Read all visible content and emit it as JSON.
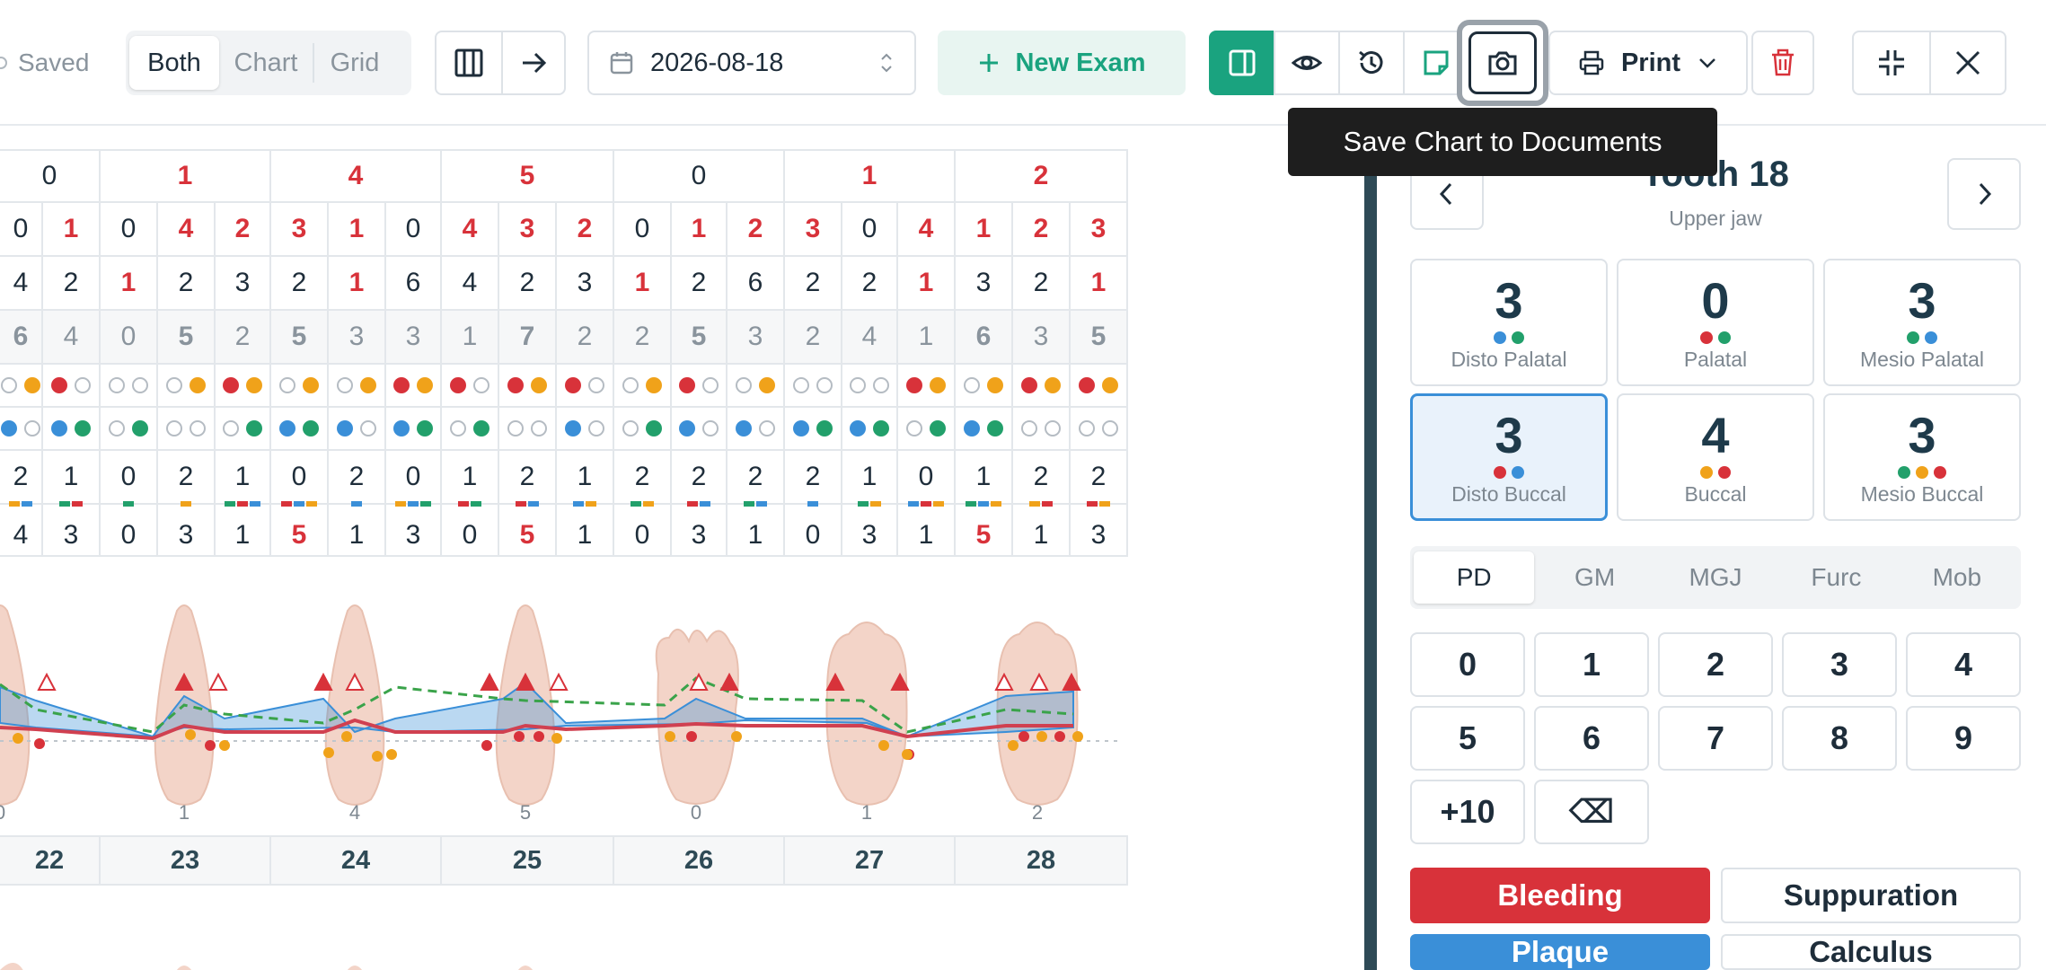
{
  "toolbar": {
    "saved_label": "Saved",
    "view_options": [
      "Both",
      "Chart",
      "Grid"
    ],
    "active_view": "Both",
    "date_value": "2026-08-18",
    "new_exam_label": "New Exam",
    "print_label": "Print",
    "tooltip": "Save Chart to Documents"
  },
  "colors": {
    "accent": "#1aa37f",
    "red": "#d8323a",
    "orange": "#f0a21a",
    "blue": "#3a8fd8",
    "green": "#22a06b",
    "dark": "#1e2d3a"
  },
  "grid": {
    "header_values": [
      "0",
      "1",
      "4",
      "5",
      "0",
      "1",
      "2"
    ],
    "pd_row": [
      "0",
      "1",
      "0",
      "4",
      "2",
      "3",
      "1",
      "0",
      "4",
      "3",
      "2",
      "0",
      "1",
      "2",
      "3",
      "0",
      "4",
      "1",
      "2",
      "3"
    ],
    "cal_row": [
      "4",
      "2",
      "1",
      "2",
      "3",
      "2",
      "1",
      "6",
      "4",
      "2",
      "3",
      "1",
      "2",
      "6",
      "2",
      "2",
      "1",
      "3",
      "2",
      "1"
    ],
    "gm_row": [
      "6",
      "4",
      "0",
      "5",
      "2",
      "5",
      "3",
      "3",
      "1",
      "7",
      "2",
      "2",
      "5",
      "3",
      "2",
      "4",
      "1",
      "6",
      "3",
      "5"
    ],
    "mgj_row": [
      "2",
      "1",
      "0",
      "2",
      "1",
      "0",
      "2",
      "0",
      "1",
      "2",
      "1",
      "2",
      "2",
      "2",
      "2",
      "1",
      "0",
      "1",
      "2",
      "2"
    ],
    "last_row": [
      "4",
      "3",
      "0",
      "3",
      "1",
      "5",
      "1",
      "3",
      "0",
      "5",
      "1",
      "0",
      "3",
      "1",
      "0",
      "3",
      "1",
      "5",
      "1",
      "3"
    ],
    "tooth_numbers": [
      "22",
      "23",
      "24",
      "25",
      "26",
      "27",
      "28"
    ],
    "chart_labels": [
      "0",
      "1",
      "4",
      "5",
      "0",
      "1",
      "2"
    ]
  },
  "panel": {
    "tooth_title": "Tooth 18",
    "jaw": "Upper jaw",
    "sites": [
      {
        "value": "3",
        "label": "Disto Palatal"
      },
      {
        "value": "0",
        "label": "Palatal"
      },
      {
        "value": "3",
        "label": "Mesio Palatal"
      },
      {
        "value": "3",
        "label": "Disto Buccal"
      },
      {
        "value": "4",
        "label": "Buccal"
      },
      {
        "value": "3",
        "label": "Mesio Buccal"
      }
    ],
    "tabs": [
      "PD",
      "GM",
      "MGJ",
      "Furc",
      "Mob"
    ],
    "active_tab": "PD",
    "keys": [
      "0",
      "1",
      "2",
      "3",
      "4",
      "5",
      "6",
      "7",
      "8",
      "9",
      "+10",
      "⌫"
    ],
    "flags": [
      "Bleeding",
      "Suppuration",
      "Plaque",
      "Calculus"
    ]
  }
}
